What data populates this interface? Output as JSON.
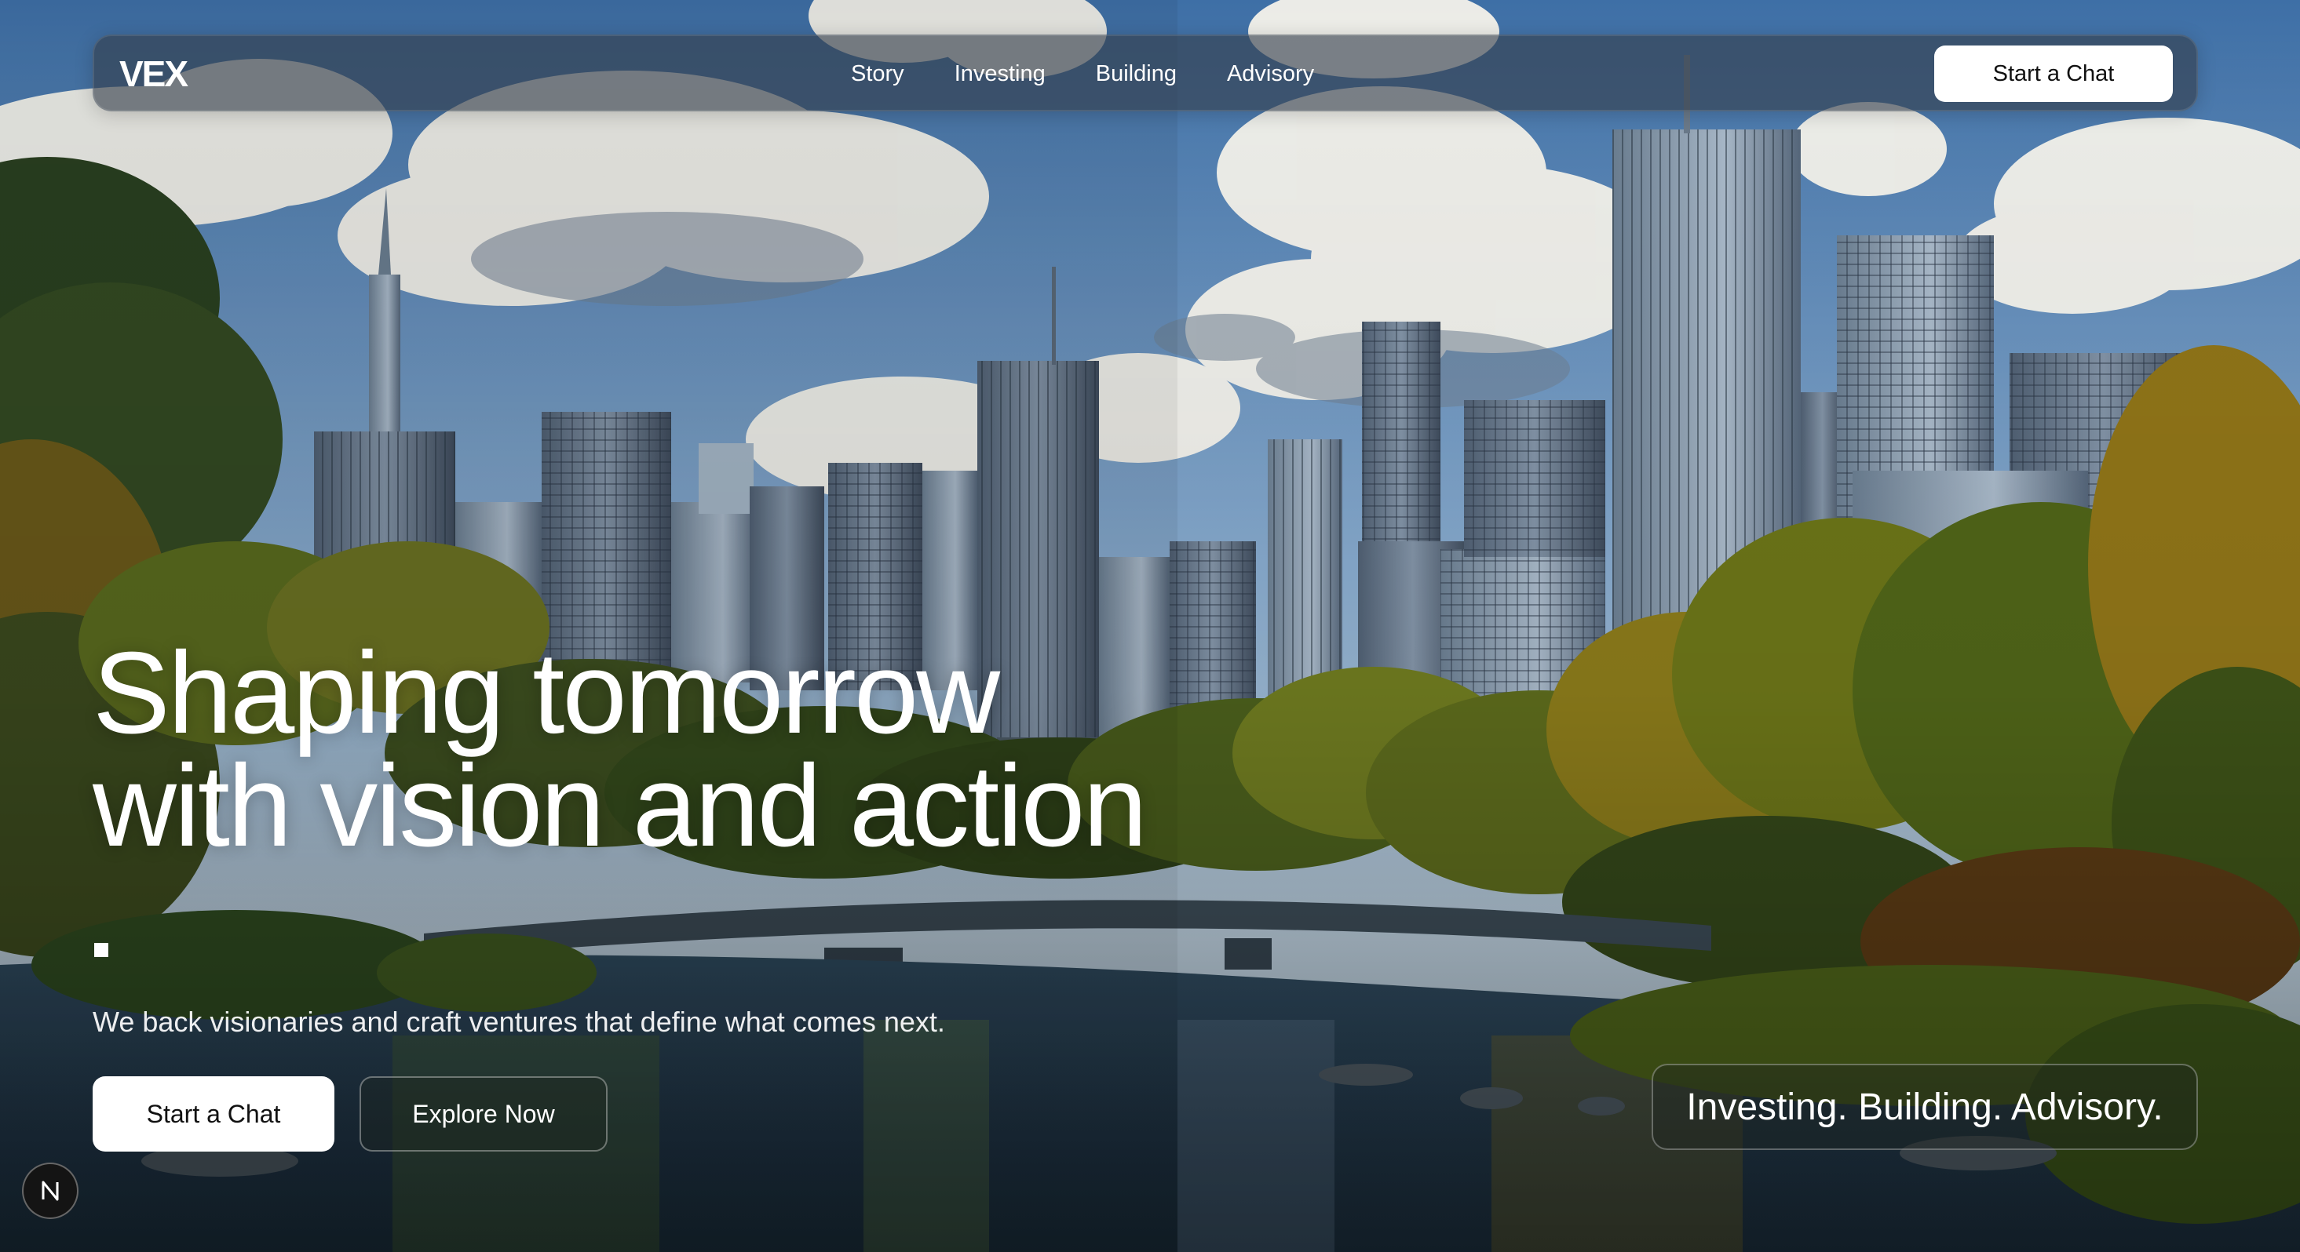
{
  "brand": {
    "name": "VEX"
  },
  "nav": {
    "links": [
      "Story",
      "Investing",
      "Building",
      "Advisory"
    ],
    "cta_label": "Start a Chat"
  },
  "hero": {
    "title_line1": "Shaping tomorrow",
    "title_line2": "with vision and action",
    "subtitle": "We back visionaries and craft ventures that define what comes next.",
    "primary_cta": "Start a Chat",
    "secondary_cta": "Explore Now",
    "tagline": "Investing. Building. Advisory."
  },
  "badge": {
    "icon": "n-logo-icon"
  },
  "colors": {
    "nav_bg": "#343e4a",
    "button_bg": "#ffffff",
    "button_text": "#111111",
    "text": "#ffffff"
  }
}
